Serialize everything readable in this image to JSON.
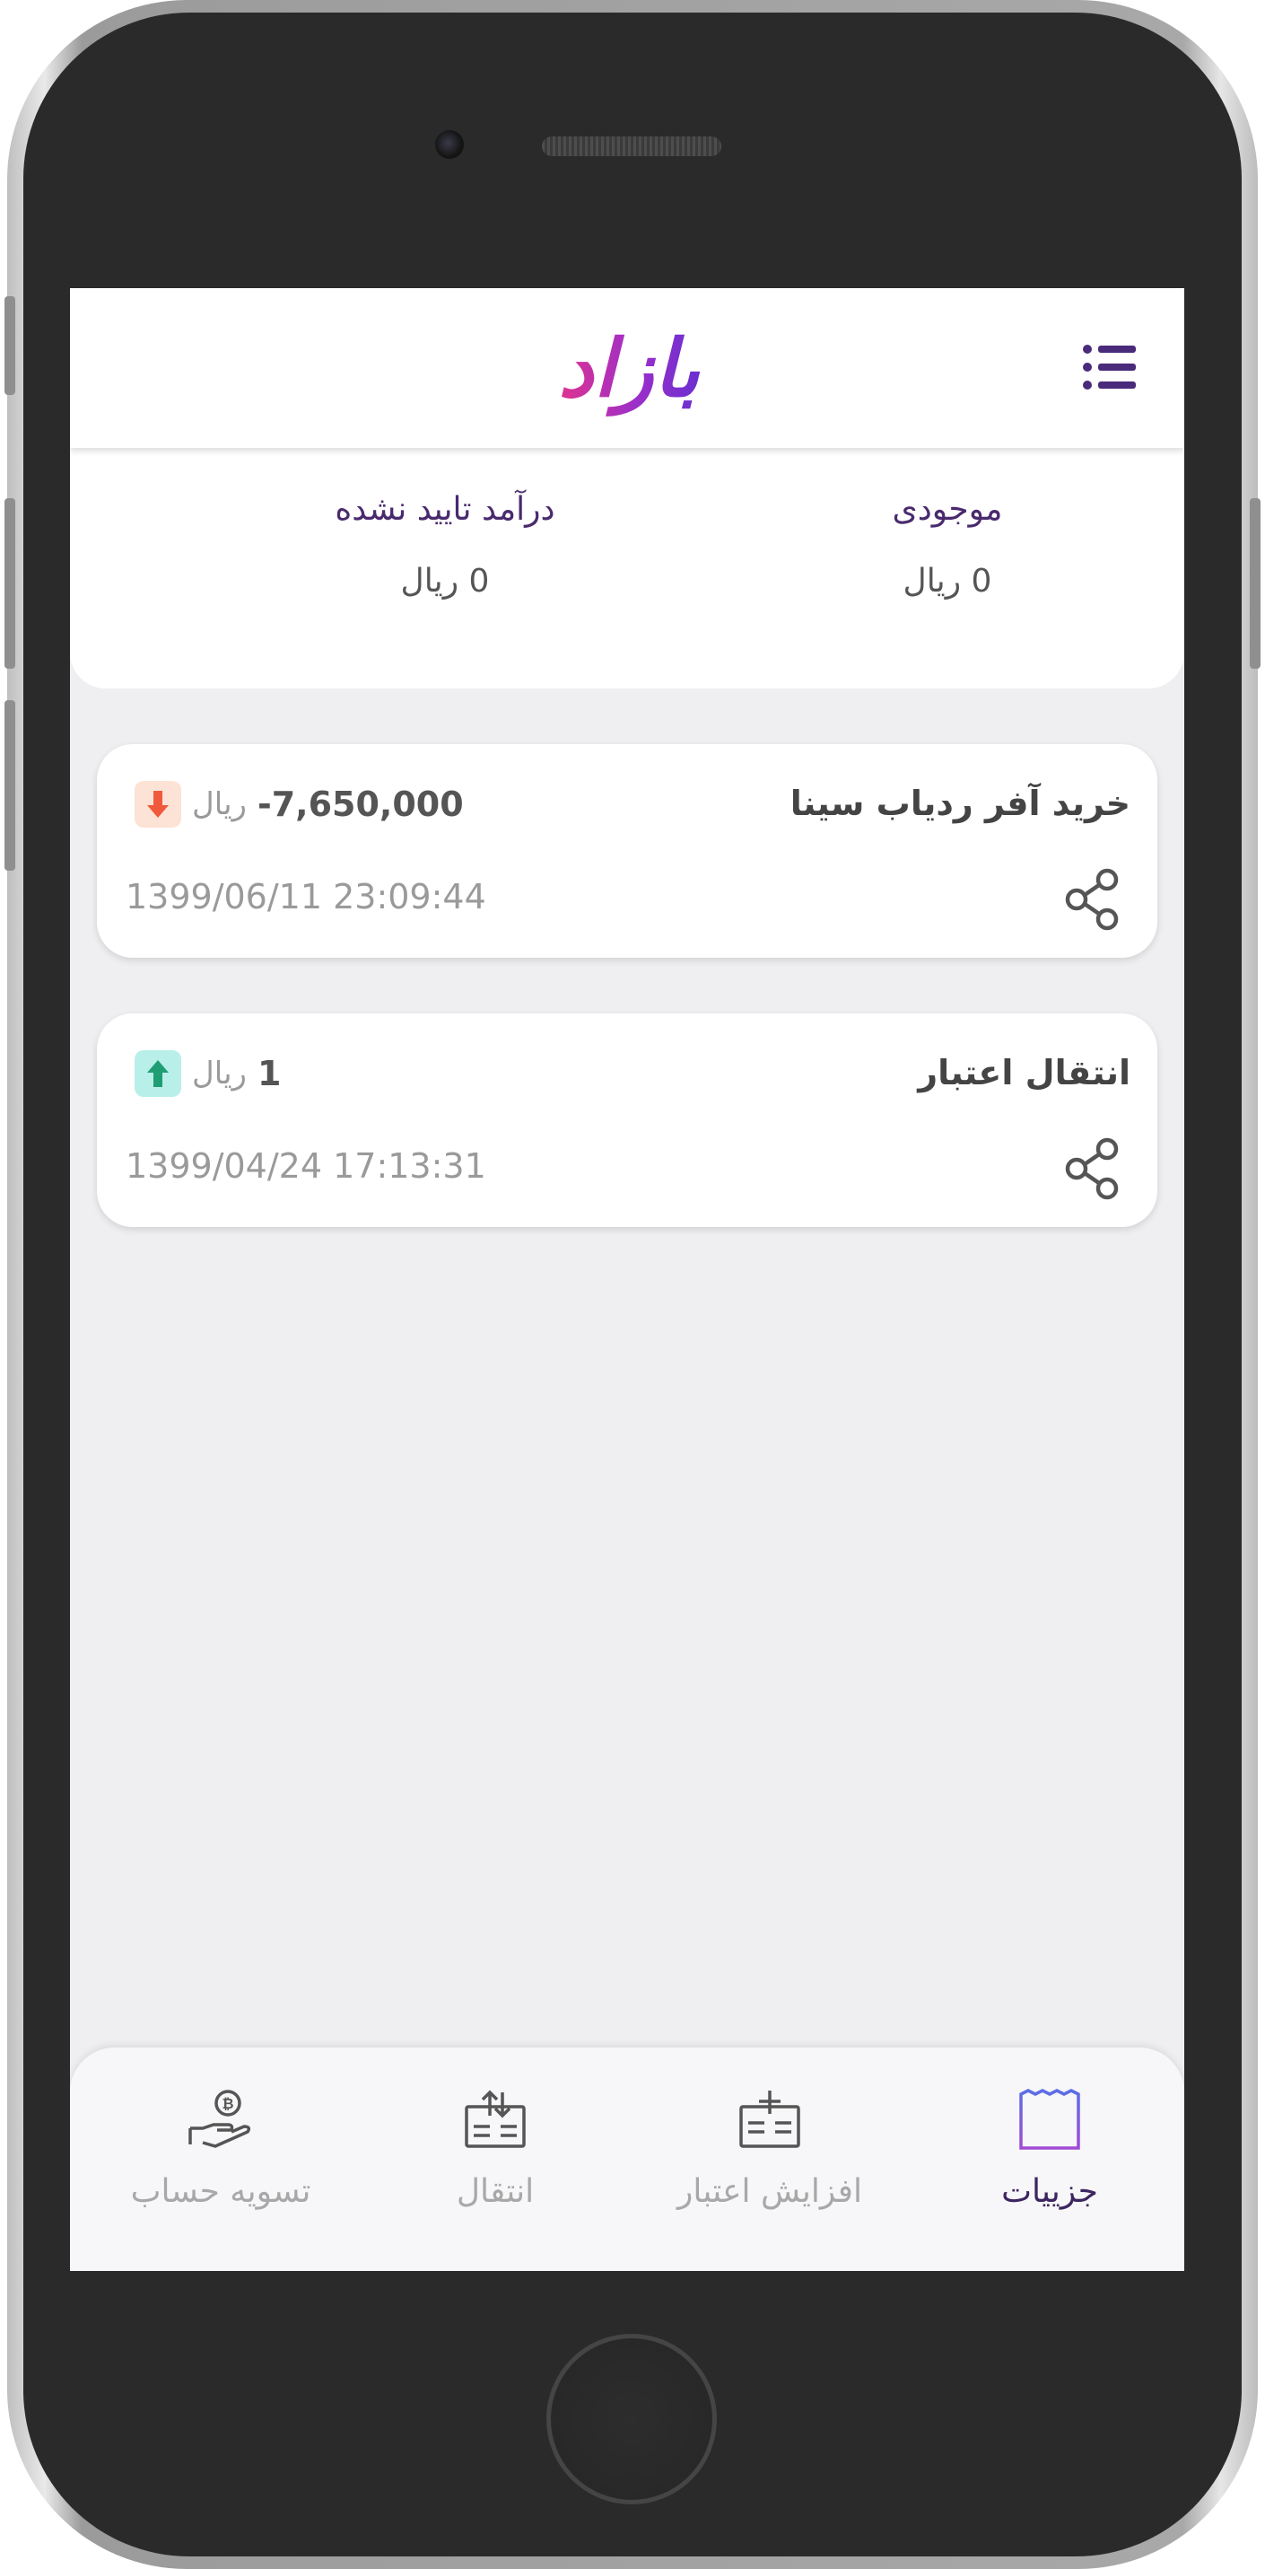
{
  "header": {
    "logo_text": "بازاد"
  },
  "balances": [
    {
      "label": "موجودی",
      "value": "0 ریال"
    },
    {
      "label": "درآمد تایید نشده",
      "value": "0 ریال"
    }
  ],
  "transactions": [
    {
      "title": "خرید آفر ردیاب سینا",
      "amount": "-7,650,000",
      "currency": "ریال",
      "direction": "down",
      "date": "1399/06/11 23:09:44"
    },
    {
      "title": "انتقال اعتبار",
      "amount": "1",
      "currency": "ریال",
      "direction": "up",
      "date": "1399/04/24 17:13:31"
    }
  ],
  "bottom_nav": [
    {
      "label": "جزییات",
      "icon": "receipt-icon",
      "active": true
    },
    {
      "label": "افزایش اعتبار",
      "icon": "add-credit-icon",
      "active": false
    },
    {
      "label": "انتقال",
      "icon": "transfer-icon",
      "active": false
    },
    {
      "label": "تسویه حساب",
      "icon": "hand-coin-icon",
      "active": false
    }
  ],
  "colors": {
    "brand_purple": "#5a2d82",
    "logo_pink": "#e0338f",
    "logo_violet": "#7b2fd4",
    "down_arrow": "#f05a3c",
    "up_arrow": "#1f9e73"
  }
}
